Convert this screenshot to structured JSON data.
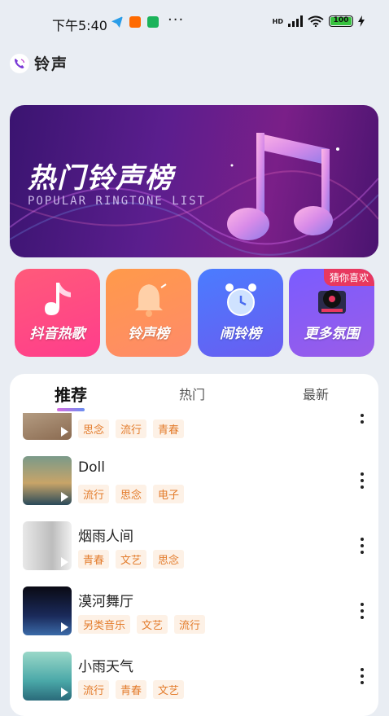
{
  "status_bar": {
    "time": "下午5:40",
    "network": "HD",
    "battery": "100"
  },
  "app": {
    "title": "铃声"
  },
  "banner": {
    "title": "热门铃声榜",
    "subtitle": "POPULAR RINGTONE LIST"
  },
  "categories": [
    {
      "label": "抖音热歌",
      "icon": "music-note-icon"
    },
    {
      "label": "铃声榜",
      "icon": "bell-icon"
    },
    {
      "label": "闹铃榜",
      "icon": "alarm-clock-icon"
    },
    {
      "label": "更多氛围",
      "icon": "vinyl-player-icon",
      "badge": "猜你喜欢"
    }
  ],
  "tabs": [
    {
      "label": "推荐",
      "active": true
    },
    {
      "label": "热门",
      "active": false
    },
    {
      "label": "最新",
      "active": false
    }
  ],
  "songs": [
    {
      "title": "",
      "tags": [
        "思念",
        "流行",
        "青春"
      ]
    },
    {
      "title": "Doll",
      "tags": [
        "流行",
        "思念",
        "电子"
      ]
    },
    {
      "title": "烟雨人间",
      "tags": [
        "青春",
        "文艺",
        "思念"
      ]
    },
    {
      "title": "漠河舞厅",
      "tags": [
        "另类音乐",
        "文艺",
        "流行"
      ]
    },
    {
      "title": "小雨天气",
      "tags": [
        "流行",
        "青春",
        "文艺"
      ]
    }
  ]
}
